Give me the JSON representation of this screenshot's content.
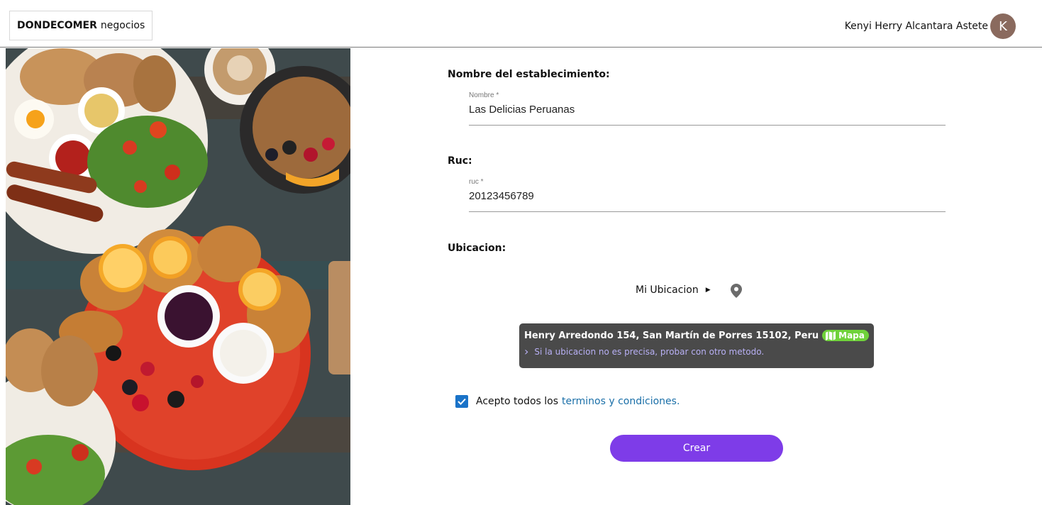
{
  "header": {
    "brand_bold": "DONDECOMER",
    "brand_light": "negocios",
    "user_name": "Kenyi Herry Alcantara Astete",
    "avatar_letter": "K"
  },
  "form": {
    "name_section": "Nombre del establecimiento:",
    "name_label": "Nombre *",
    "name_value": "Las Delicias Peruanas",
    "ruc_section": "Ruc:",
    "ruc_label": "ruc *",
    "ruc_value": "20123456789",
    "location_section": "Ubicacion:",
    "my_location": "Mi Ubicacion",
    "address": "Henry Arredondo 154, San Martín de Porres 15102, Peru",
    "map_label": "Mapa",
    "alt_method": "Si la ubicacion no es precisa, probar con otro metodo.",
    "terms_prefix": "Acepto todos los",
    "terms_link": "terminos y condiciones.",
    "submit": "Crear"
  },
  "colors": {
    "primary_button": "#7e3ce8",
    "checkbox": "#1a73c8",
    "link": "#1a6fa8",
    "map_badge": "#6fd23a",
    "location_card": "#4a4a4a",
    "avatar": "#8a6a5e"
  },
  "icons": {
    "pin": "location-pin-icon",
    "map": "map-icon",
    "chevron": "chevron-right-icon",
    "caret": "caret-right-icon",
    "check": "check-icon"
  }
}
